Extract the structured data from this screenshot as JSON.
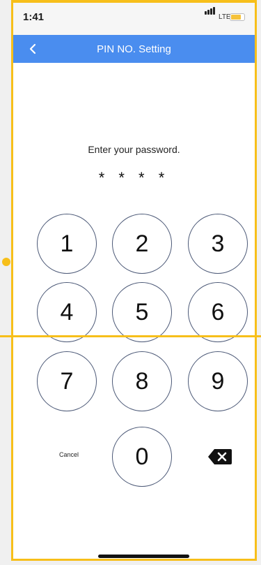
{
  "status_bar": {
    "time": "1:41",
    "carrier": "LTE"
  },
  "nav": {
    "title": "PIN NO. Setting"
  },
  "prompt": "Enter your password.",
  "pin_display": "* * * *",
  "keypad": {
    "keys": [
      "1",
      "2",
      "3",
      "4",
      "5",
      "6",
      "7",
      "8",
      "9",
      "0"
    ],
    "cancel_label": "Cancel"
  },
  "colors": {
    "nav_bar": "#4a8def",
    "key_border": "#4b5876",
    "annotation": "#f7bf1a"
  }
}
